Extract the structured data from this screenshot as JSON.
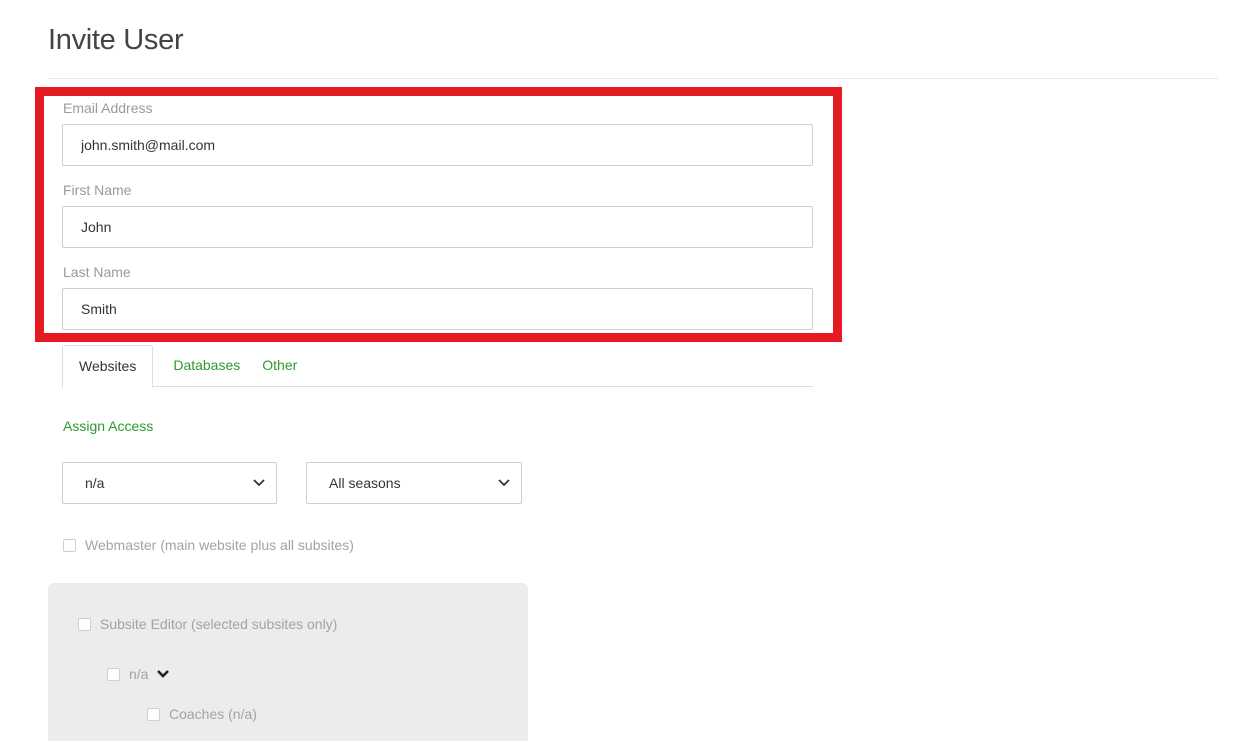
{
  "page": {
    "title": "Invite User"
  },
  "form": {
    "email_label": "Email Address",
    "email_value": "john.smith@mail.com",
    "first_name_label": "First Name",
    "first_name_value": "John",
    "last_name_label": "Last Name",
    "last_name_value": "Smith"
  },
  "tabs": [
    {
      "label": "Websites",
      "active": true
    },
    {
      "label": "Databases",
      "active": false
    },
    {
      "label": "Other",
      "active": false
    }
  ],
  "access": {
    "assign_label": "Assign Access",
    "website_select": "n/a",
    "season_select": "All seasons",
    "webmaster_label": "Webmaster (main website plus all subsites)",
    "subsite_editor_label": "Subsite Editor (selected subsites only)",
    "subsite_item_label": "n/a",
    "coaches_label": "Coaches (n/a)"
  },
  "colors": {
    "accent_green": "#2e9a2e",
    "highlight_red": "#e41b23",
    "panel_gray": "#ececec"
  },
  "icons": {
    "select_chevron": "chevron-down-icon",
    "expand_chevron": "chevron-down-icon"
  }
}
